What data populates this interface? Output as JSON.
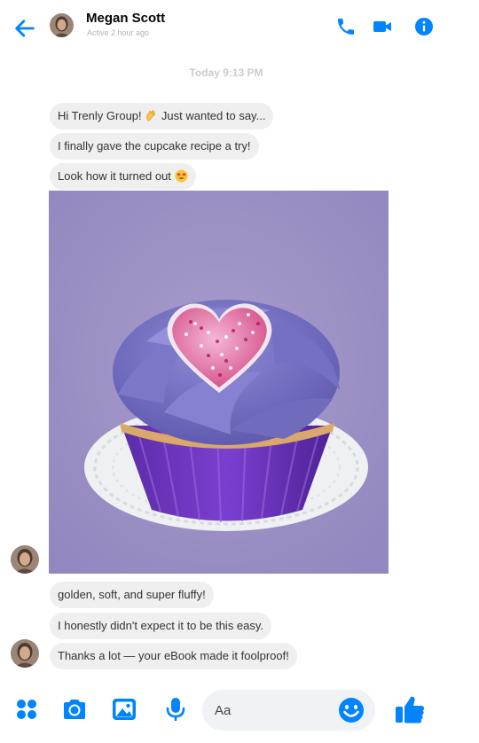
{
  "header": {
    "contact_name": "Megan Scott",
    "status": "Active 2 hour ago"
  },
  "thread": {
    "timestamp": "Today 9:13 PM",
    "messages": [
      {
        "text": "Hi Trenly Group! ",
        "suffix": " Just wanted to say...",
        "emoji": "waving-hand"
      },
      {
        "text": "I finally gave the cupcake recipe a try!"
      },
      {
        "text": "Look how it turned out ",
        "emoji": "heart-eyes-face"
      },
      {
        "text": "golden, soft, and super fluffy!"
      },
      {
        "text": "I honestly didn't expect it to be this easy."
      },
      {
        "text": "Thanks a lot — your eBook made it foolproof!"
      }
    ],
    "photo": {
      "subject": "cupcake-photo"
    }
  },
  "composer": {
    "placeholder": "Aa"
  },
  "colors": {
    "accent": "#0084ff",
    "bubble": "#efefef",
    "muted": "#b0b3b8"
  },
  "icons": [
    "back-arrow-icon",
    "phone-icon",
    "video-camera-icon",
    "info-icon",
    "apps-grid-icon",
    "camera-icon",
    "gallery-icon",
    "microphone-icon",
    "smiley-icon",
    "thumbs-up-icon"
  ]
}
